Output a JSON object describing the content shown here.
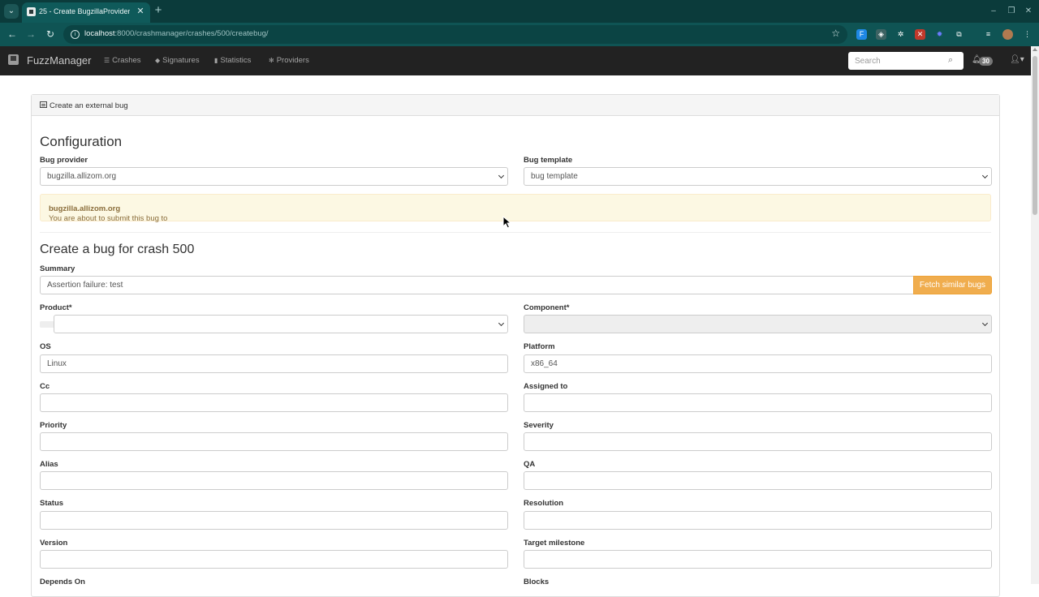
{
  "browser": {
    "tab_title": "25 - Create BugzillaProvider B",
    "url_host": "localhost",
    "url_path": ":8000/crashmanager/crashes/500/createbug/"
  },
  "app": {
    "brand": "FuzzManager",
    "nav": [
      {
        "label": "Crashes",
        "icon": "list-icon"
      },
      {
        "label": "Signatures",
        "icon": "tag-icon"
      },
      {
        "label": "Statistics",
        "icon": "bar-chart-icon"
      },
      {
        "label": "Providers",
        "icon": "gear-icon"
      }
    ],
    "search_placeholder": "Search",
    "notifications_count": "30"
  },
  "panel": {
    "title": "Create an external bug",
    "configuration_heading": "Configuration",
    "bug_provider_label": "Bug provider",
    "bug_provider_value": "bugzilla.allizom.org",
    "bug_template_label": "Bug template",
    "bug_template_value": "bug template",
    "alert_prefix": "You are about to submit this bug to ",
    "alert_host": "bugzilla.allizom.org",
    "create_heading": "Create a bug for crash 500",
    "summary_label": "Summary",
    "summary_value": "Assertion failure: test",
    "fetch_button": "Fetch similar bugs",
    "fields": {
      "product_label": "Product*",
      "component_label": "Component*",
      "os_label": "OS",
      "os_value": "Linux",
      "platform_label": "Platform",
      "platform_value": "x86_64",
      "cc_label": "Cc",
      "assigned_label": "Assigned to",
      "priority_label": "Priority",
      "severity_label": "Severity",
      "alias_label": "Alias",
      "qa_label": "QA",
      "status_label": "Status",
      "resolution_label": "Resolution",
      "version_label": "Version",
      "milestone_label": "Target milestone",
      "depends_label": "Depends On",
      "blocks_label": "Blocks"
    }
  }
}
